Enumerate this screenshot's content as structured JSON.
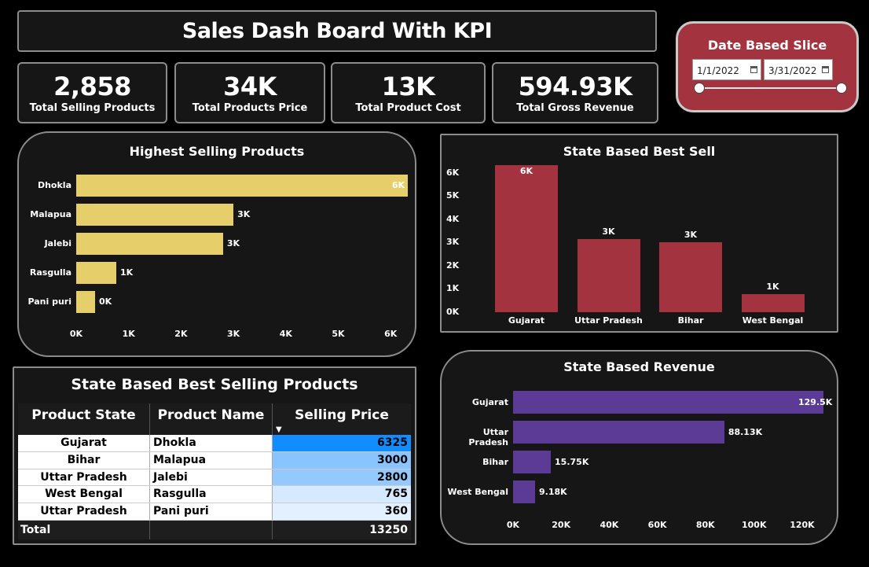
{
  "header": {
    "title": "Sales Dash Board With KPI"
  },
  "kpis": [
    {
      "value": "2,858",
      "label": "Total Selling Products"
    },
    {
      "value": "34K",
      "label": "Total Products Price"
    },
    {
      "value": "13K",
      "label": "Total  Product Cost"
    },
    {
      "value": "594.93K",
      "label": "Total Gross Revenue"
    }
  ],
  "slicer": {
    "title": "Date Based Slice",
    "start": "1/1/2022",
    "end": "3/31/2022"
  },
  "colors": {
    "product_bar": "#e6cf6a",
    "state_bar": "#a3343f",
    "revenue_bar": "#5b3b96",
    "slicer_bg": "#a3343f"
  },
  "chart_data": [
    {
      "type": "bar",
      "orientation": "horizontal",
      "title": "Highest Selling Products",
      "categories": [
        "Dhokla",
        "Malapua",
        "Jalebi",
        "Rasgulla",
        "Pani puri"
      ],
      "values": [
        6325,
        3000,
        2800,
        765,
        360
      ],
      "data_labels": [
        "6K",
        "3K",
        "3K",
        "1K",
        "0K"
      ],
      "xticks": [
        "0K",
        "1K",
        "2K",
        "3K",
        "4K",
        "5K",
        "6K"
      ],
      "xlim": [
        0,
        6325
      ]
    },
    {
      "type": "bar",
      "orientation": "vertical",
      "title": "State Based Best Sell",
      "categories": [
        "Gujarat",
        "Uttar Pradesh",
        "Bihar",
        "West Bengal"
      ],
      "values": [
        6325,
        3160,
        3000,
        765
      ],
      "data_labels": [
        "6K",
        "3K",
        "3K",
        "1K"
      ],
      "yticks": [
        "0K",
        "1K",
        "2K",
        "3K",
        "4K",
        "5K",
        "6K"
      ],
      "ylim": [
        0,
        6325
      ]
    },
    {
      "type": "bar",
      "orientation": "horizontal",
      "title": "State Based Revenue",
      "categories": [
        "Gujarat",
        "Uttar Pradesh",
        "Bihar",
        "West Bengal"
      ],
      "values": [
        129500,
        88130,
        15750,
        9180
      ],
      "data_labels": [
        "129.5K",
        "88.13K",
        "15.75K",
        "9.18K"
      ],
      "xticks": [
        "0K",
        "20K",
        "40K",
        "60K",
        "80K",
        "100K",
        "120K"
      ],
      "xlim": [
        0,
        129500
      ]
    }
  ],
  "table": {
    "title": "State Based Best Selling Products",
    "columns": [
      "Product State",
      "Product Name",
      "Selling Price"
    ],
    "rows": [
      {
        "state": "Gujarat",
        "product": "Dhokla",
        "price": "6325",
        "shade": "#118dff"
      },
      {
        "state": "Bihar",
        "product": "Malapua",
        "price": "3000",
        "shade": "#89c4ff"
      },
      {
        "state": "Uttar Pradesh",
        "product": "Jalebi",
        "price": "2800",
        "shade": "#94c9ff"
      },
      {
        "state": "West Bengal",
        "product": "Rasgulla",
        "price": "765",
        "shade": "#d6eaff"
      },
      {
        "state": "Uttar Pradesh",
        "product": "Pani puri",
        "price": "360",
        "shade": "#e2f0ff"
      }
    ],
    "total_label": "Total",
    "total_value": "13250"
  }
}
